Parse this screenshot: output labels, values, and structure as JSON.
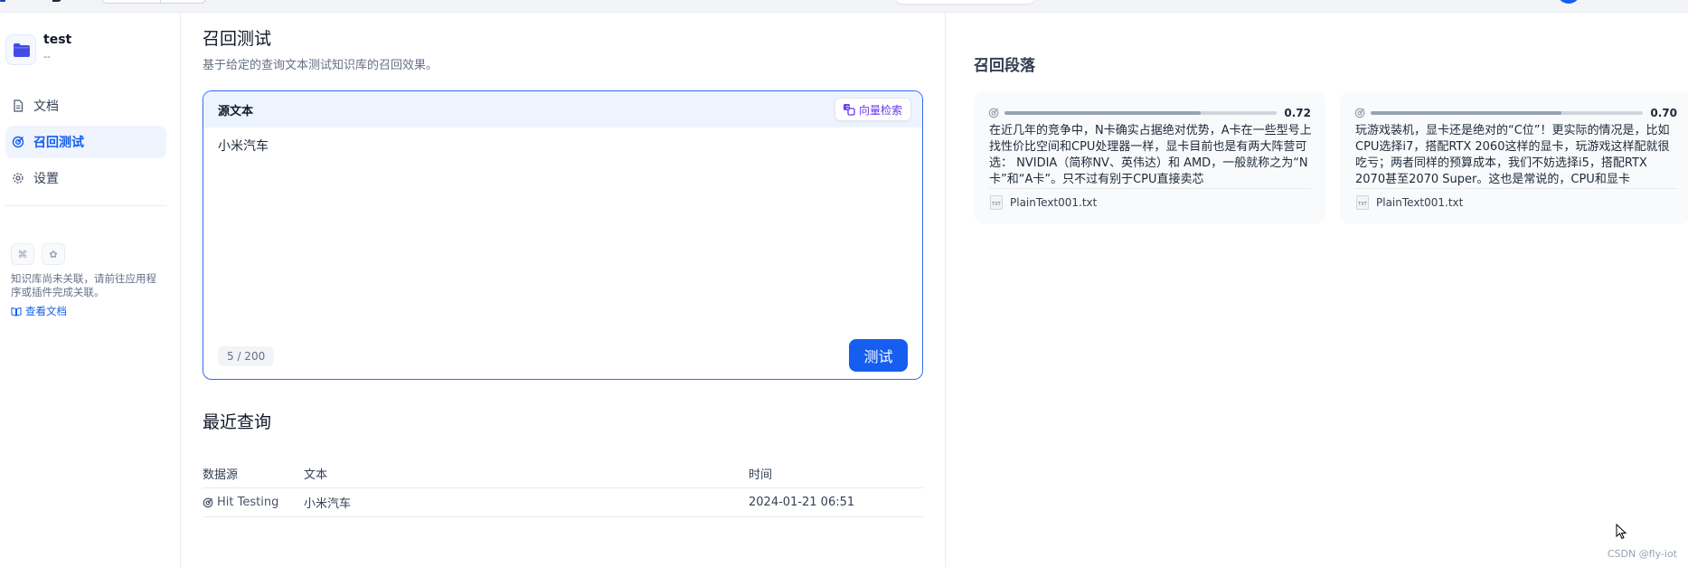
{
  "sidebar": {
    "dataset": {
      "name": "test",
      "description": "--"
    },
    "nav": [
      {
        "label": "文档",
        "icon": "document-icon"
      },
      {
        "label": "召回测试",
        "icon": "target-icon",
        "active": true
      },
      {
        "label": "设置",
        "icon": "gear-icon"
      }
    ],
    "association": {
      "message": "知识库尚未关联，请前往应用程序或插件完成关联。",
      "link_label": "查看文档"
    }
  },
  "main": {
    "title": "召回测试",
    "description": "基于给定的查询文本测试知识库的召回效果。",
    "source": {
      "title": "源文本",
      "vector_button_label": "向量检索",
      "text": "小米汽车",
      "char_count": "5 / 200",
      "test_button_label": "测试"
    },
    "recent": {
      "title": "最近查询",
      "columns": [
        "数据源",
        "文本",
        "时间"
      ],
      "rows": [
        {
          "source": "Hit Testing",
          "text": "小米汽车",
          "time": "2024-01-21 06:51"
        }
      ]
    }
  },
  "results": {
    "title": "召回段落",
    "cards": [
      {
        "score": "0.72",
        "score_value": 0.72,
        "content": "在近几年的竞争中，N卡确实占据绝对优势，A卡在一些型号上找性价比空间和CPU处理器一样，显卡目前也是有两大阵营可选： NVIDIA（简称NV、英伟达）和 AMD，一般就称之为“N卡”和“A卡”。只不过有别于CPU直接卖芯",
        "file": "PlainText001.txt"
      },
      {
        "score": "0.70",
        "score_value": 0.7,
        "content": "玩游戏装机，显卡还是绝对的“C位”！更实际的情况是，比如CPU选择i7，搭配RTX 2060这样的显卡，玩游戏这样配就很吃亏；两者同样的预算成本，我们不妨选择i5，搭配RTX 2070甚至2070 Super。这也是常说的，CPU和显卡",
        "file": "PlainText001.txt"
      }
    ]
  },
  "watermark": "CSDN @fly-iot",
  "colors": {
    "primary": "#155eef",
    "accent_purple": "#6938ef",
    "active_bg": "#eff4ff"
  }
}
